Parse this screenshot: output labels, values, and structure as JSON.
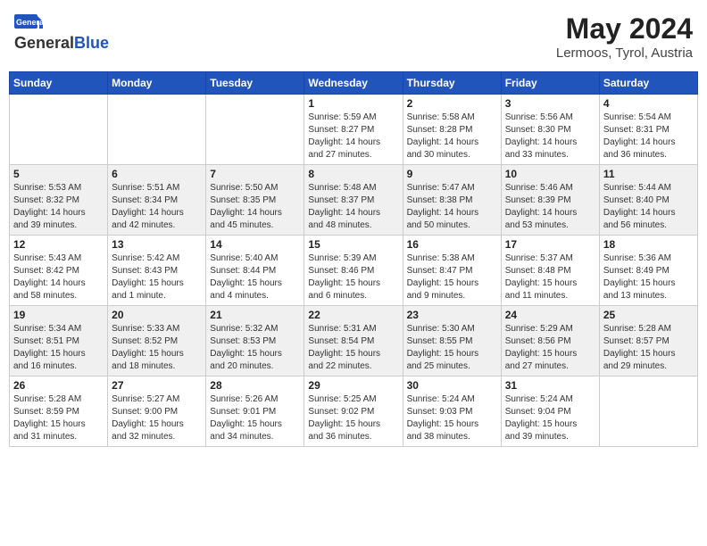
{
  "header": {
    "logo_general": "General",
    "logo_blue": "Blue",
    "month_title": "May 2024",
    "location": "Lermoos, Tyrol, Austria"
  },
  "days_of_week": [
    "Sunday",
    "Monday",
    "Tuesday",
    "Wednesday",
    "Thursday",
    "Friday",
    "Saturday"
  ],
  "weeks": [
    [
      {
        "day": "",
        "info": ""
      },
      {
        "day": "",
        "info": ""
      },
      {
        "day": "",
        "info": ""
      },
      {
        "day": "1",
        "info": "Sunrise: 5:59 AM\nSunset: 8:27 PM\nDaylight: 14 hours\nand 27 minutes."
      },
      {
        "day": "2",
        "info": "Sunrise: 5:58 AM\nSunset: 8:28 PM\nDaylight: 14 hours\nand 30 minutes."
      },
      {
        "day": "3",
        "info": "Sunrise: 5:56 AM\nSunset: 8:30 PM\nDaylight: 14 hours\nand 33 minutes."
      },
      {
        "day": "4",
        "info": "Sunrise: 5:54 AM\nSunset: 8:31 PM\nDaylight: 14 hours\nand 36 minutes."
      }
    ],
    [
      {
        "day": "5",
        "info": "Sunrise: 5:53 AM\nSunset: 8:32 PM\nDaylight: 14 hours\nand 39 minutes."
      },
      {
        "day": "6",
        "info": "Sunrise: 5:51 AM\nSunset: 8:34 PM\nDaylight: 14 hours\nand 42 minutes."
      },
      {
        "day": "7",
        "info": "Sunrise: 5:50 AM\nSunset: 8:35 PM\nDaylight: 14 hours\nand 45 minutes."
      },
      {
        "day": "8",
        "info": "Sunrise: 5:48 AM\nSunset: 8:37 PM\nDaylight: 14 hours\nand 48 minutes."
      },
      {
        "day": "9",
        "info": "Sunrise: 5:47 AM\nSunset: 8:38 PM\nDaylight: 14 hours\nand 50 minutes."
      },
      {
        "day": "10",
        "info": "Sunrise: 5:46 AM\nSunset: 8:39 PM\nDaylight: 14 hours\nand 53 minutes."
      },
      {
        "day": "11",
        "info": "Sunrise: 5:44 AM\nSunset: 8:40 PM\nDaylight: 14 hours\nand 56 minutes."
      }
    ],
    [
      {
        "day": "12",
        "info": "Sunrise: 5:43 AM\nSunset: 8:42 PM\nDaylight: 14 hours\nand 58 minutes."
      },
      {
        "day": "13",
        "info": "Sunrise: 5:42 AM\nSunset: 8:43 PM\nDaylight: 15 hours\nand 1 minute."
      },
      {
        "day": "14",
        "info": "Sunrise: 5:40 AM\nSunset: 8:44 PM\nDaylight: 15 hours\nand 4 minutes."
      },
      {
        "day": "15",
        "info": "Sunrise: 5:39 AM\nSunset: 8:46 PM\nDaylight: 15 hours\nand 6 minutes."
      },
      {
        "day": "16",
        "info": "Sunrise: 5:38 AM\nSunset: 8:47 PM\nDaylight: 15 hours\nand 9 minutes."
      },
      {
        "day": "17",
        "info": "Sunrise: 5:37 AM\nSunset: 8:48 PM\nDaylight: 15 hours\nand 11 minutes."
      },
      {
        "day": "18",
        "info": "Sunrise: 5:36 AM\nSunset: 8:49 PM\nDaylight: 15 hours\nand 13 minutes."
      }
    ],
    [
      {
        "day": "19",
        "info": "Sunrise: 5:34 AM\nSunset: 8:51 PM\nDaylight: 15 hours\nand 16 minutes."
      },
      {
        "day": "20",
        "info": "Sunrise: 5:33 AM\nSunset: 8:52 PM\nDaylight: 15 hours\nand 18 minutes."
      },
      {
        "day": "21",
        "info": "Sunrise: 5:32 AM\nSunset: 8:53 PM\nDaylight: 15 hours\nand 20 minutes."
      },
      {
        "day": "22",
        "info": "Sunrise: 5:31 AM\nSunset: 8:54 PM\nDaylight: 15 hours\nand 22 minutes."
      },
      {
        "day": "23",
        "info": "Sunrise: 5:30 AM\nSunset: 8:55 PM\nDaylight: 15 hours\nand 25 minutes."
      },
      {
        "day": "24",
        "info": "Sunrise: 5:29 AM\nSunset: 8:56 PM\nDaylight: 15 hours\nand 27 minutes."
      },
      {
        "day": "25",
        "info": "Sunrise: 5:28 AM\nSunset: 8:57 PM\nDaylight: 15 hours\nand 29 minutes."
      }
    ],
    [
      {
        "day": "26",
        "info": "Sunrise: 5:28 AM\nSunset: 8:59 PM\nDaylight: 15 hours\nand 31 minutes."
      },
      {
        "day": "27",
        "info": "Sunrise: 5:27 AM\nSunset: 9:00 PM\nDaylight: 15 hours\nand 32 minutes."
      },
      {
        "day": "28",
        "info": "Sunrise: 5:26 AM\nSunset: 9:01 PM\nDaylight: 15 hours\nand 34 minutes."
      },
      {
        "day": "29",
        "info": "Sunrise: 5:25 AM\nSunset: 9:02 PM\nDaylight: 15 hours\nand 36 minutes."
      },
      {
        "day": "30",
        "info": "Sunrise: 5:24 AM\nSunset: 9:03 PM\nDaylight: 15 hours\nand 38 minutes."
      },
      {
        "day": "31",
        "info": "Sunrise: 5:24 AM\nSunset: 9:04 PM\nDaylight: 15 hours\nand 39 minutes."
      },
      {
        "day": "",
        "info": ""
      }
    ]
  ]
}
